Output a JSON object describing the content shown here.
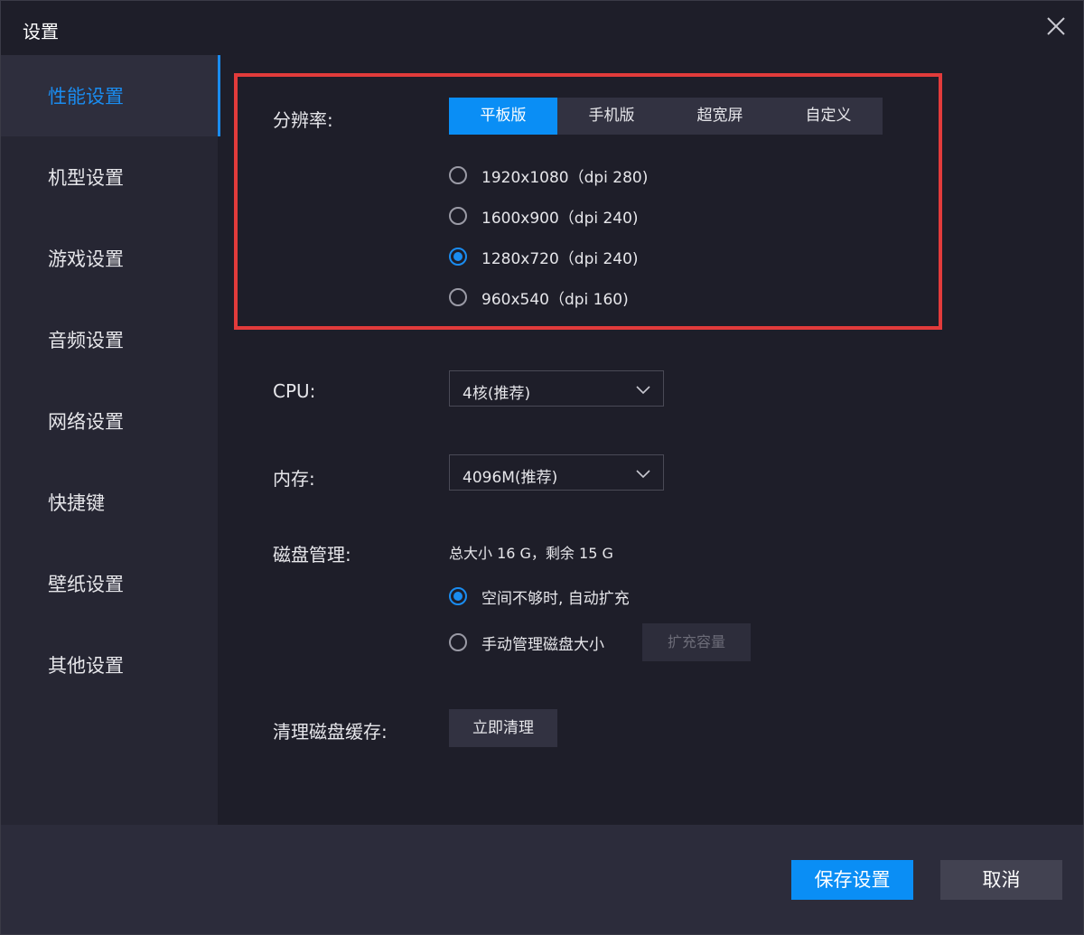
{
  "window": {
    "title": "设置",
    "close_icon": "close-icon"
  },
  "sidebar": {
    "items": [
      {
        "label": "性能设置",
        "active": true
      },
      {
        "label": "机型设置"
      },
      {
        "label": "游戏设置"
      },
      {
        "label": "音频设置"
      },
      {
        "label": "网络设置"
      },
      {
        "label": "快捷键"
      },
      {
        "label": "壁纸设置"
      },
      {
        "label": "其他设置"
      }
    ]
  },
  "resolution": {
    "label": "分辨率:",
    "tabs": [
      "平板版",
      "手机版",
      "超宽屏",
      "自定义"
    ],
    "active_tab": "平板版",
    "options": [
      "1920x1080（dpi 280)",
      "1600x900（dpi 240)",
      "1280x720（dpi 240)",
      "960x540（dpi 160)"
    ],
    "selected": "1280x720（dpi 240)"
  },
  "cpu": {
    "label": "CPU:",
    "value": "4核(推荐)"
  },
  "memory": {
    "label": "内存:",
    "value": "4096M(推荐)"
  },
  "disk": {
    "label": "磁盘管理:",
    "info": "总大小 16 G，剩余 15 G",
    "options": [
      "空间不够时, 自动扩充",
      "手动管理磁盘大小"
    ],
    "selected": "空间不够时, 自动扩充",
    "expand_button": "扩充容量"
  },
  "cache": {
    "label": "清理磁盘缓存:",
    "button": "立即清理"
  },
  "footer": {
    "save": "保存设置",
    "cancel": "取消"
  },
  "colors": {
    "accent": "#0a8ef5",
    "highlight_border": "#e23b3b",
    "background": "#1e1e29",
    "sidebar": "#262633"
  }
}
